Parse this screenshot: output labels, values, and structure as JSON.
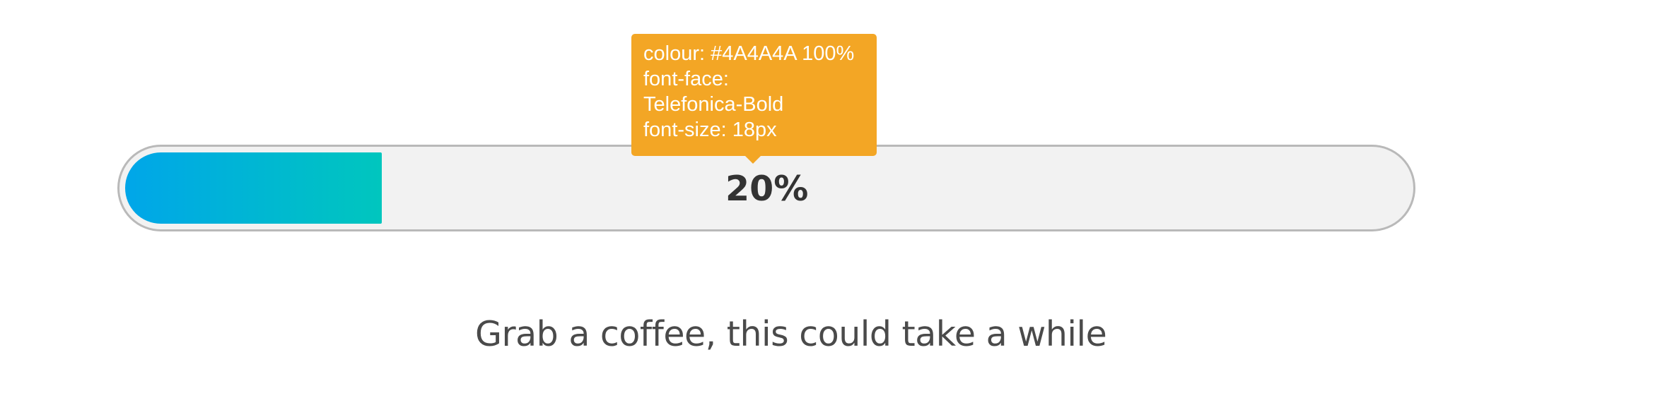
{
  "progress": {
    "value_percent": 20,
    "label": "20%",
    "fill_gradient": [
      "#00A6E9",
      "#00C6BE"
    ],
    "track_color": "#F2F2F2",
    "border_color": "#B9B9B9"
  },
  "tooltip": {
    "lines": [
      "colour: #4A4A4A 100%",
      "font-face:",
      "Telefonica-Bold",
      "font-size: 18px"
    ],
    "background_color": "#F3A625"
  },
  "message": "Grab a coffee, this could take a while"
}
